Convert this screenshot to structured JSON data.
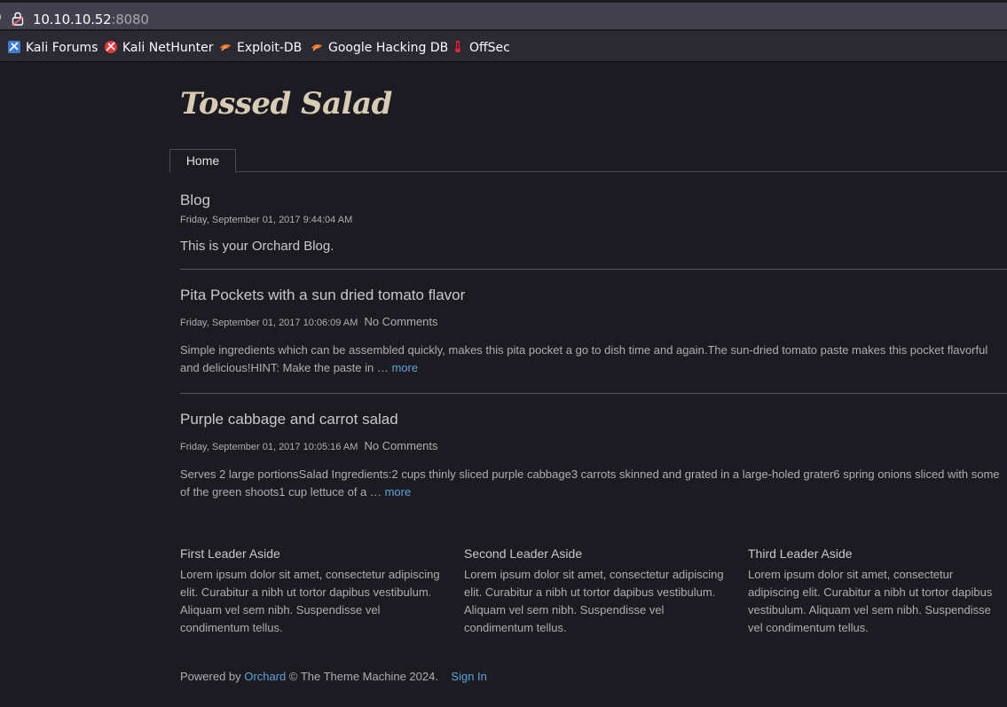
{
  "browser": {
    "url_host": "10.10.10.52",
    "url_port": ":8080",
    "bookmarks": [
      {
        "label": "Kali Forums",
        "icon": "kali-forums-icon"
      },
      {
        "label": "Kali NetHunter",
        "icon": "kali-nethunter-icon"
      },
      {
        "label": "Exploit-DB",
        "icon": "exploit-db-icon"
      },
      {
        "label": "Google Hacking DB",
        "icon": "ghdb-icon"
      },
      {
        "label": "OffSec",
        "icon": "offsec-icon"
      }
    ]
  },
  "site": {
    "title": "Tossed Salad",
    "nav": {
      "home": "Home"
    }
  },
  "blog": {
    "title": "Blog",
    "date": "Friday, September 01, 2017 9:44:04 AM",
    "description": "This is your Orchard Blog."
  },
  "posts": [
    {
      "title": "Pita Pockets with a sun dried tomato flavor",
      "date": "Friday, September 01, 2017 10:06:09 AM",
      "comments": "No Comments",
      "excerpt": "Simple ingredients which can be assembled quickly, makes this pita pocket a go to dish time and again.The sun-dried tomato paste makes this pocket flavorful and delicious!HINT:  Make the paste in …",
      "more": "more"
    },
    {
      "title": "Purple cabbage and carrot salad",
      "date": "Friday, September 01, 2017 10:05:16 AM",
      "comments": "No Comments",
      "excerpt": "Serves 2 large portionsSalad Ingredients:2 cups thinly sliced purple cabbage3 carrots skinned and grated in a large-holed grater6 spring onions sliced with some of the green shoots1 cup lettuce of a …",
      "more": "more"
    }
  ],
  "asides": [
    {
      "title": "First Leader Aside",
      "text": "Lorem ipsum dolor sit amet, consectetur adipiscing elit. Curabitur a nibh ut tortor dapibus vestibulum. Aliquam vel sem nibh. Suspendisse vel condimentum tellus."
    },
    {
      "title": "Second Leader Aside",
      "text": "Lorem ipsum dolor sit amet, consectetur adipiscing elit. Curabitur a nibh ut tortor dapibus vestibulum. Aliquam vel sem nibh. Suspendisse vel condimentum tellus."
    },
    {
      "title": "Third Leader Aside",
      "text": "Lorem ipsum dolor sit amet, consectetur adipiscing elit. Curabitur a nibh ut tortor dapibus vestibulum. Aliquam vel sem nibh. Suspendisse vel condimentum tellus."
    }
  ],
  "footer": {
    "powered_by": "Powered by",
    "orchard": "Orchard",
    "copyright": "© The Theme Machine 2024.",
    "sign_in": "Sign In"
  },
  "colors": {
    "page_bg": "#1c1b22",
    "link": "#5ea3d6",
    "title": "#d8cbb4"
  }
}
